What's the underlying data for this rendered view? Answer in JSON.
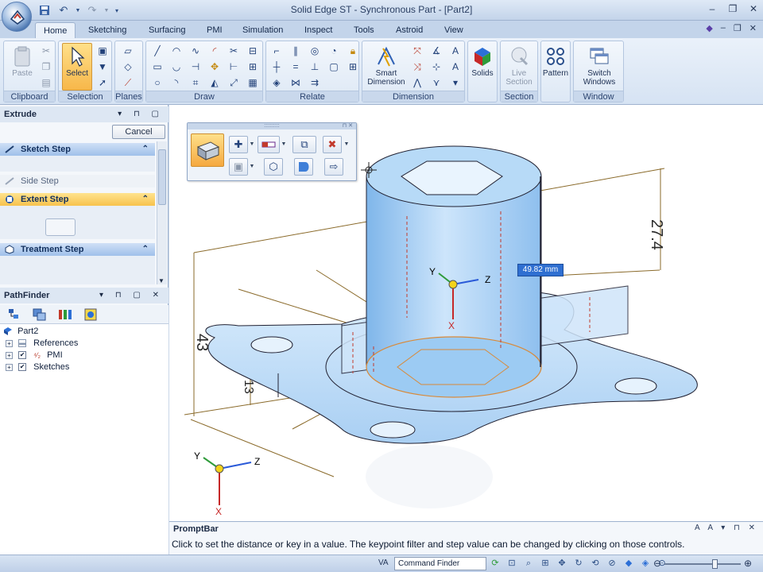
{
  "window": {
    "title": "Solid Edge ST - Synchronous Part - [Part2]",
    "controls": [
      "minimize",
      "restore",
      "close"
    ]
  },
  "quick_access": [
    "save-icon",
    "undo-icon",
    "redo-icon",
    "customize-icon"
  ],
  "tabs": [
    "Home",
    "Sketching",
    "Surfacing",
    "PMI",
    "Simulation",
    "Inspect",
    "Tools",
    "Astroid",
    "View"
  ],
  "active_tab": "Home",
  "ribbon": {
    "clipboard": {
      "label": "Clipboard",
      "paste": "Paste"
    },
    "selection": {
      "label": "Selection",
      "select": "Select"
    },
    "planes": {
      "label": "Planes"
    },
    "draw": {
      "label": "Draw"
    },
    "relate": {
      "label": "Relate"
    },
    "dimension": {
      "label": "Dimension",
      "smart_dimension_1": "Smart",
      "smart_dimension_2": "Dimension"
    },
    "solids": {
      "label": "Solids"
    },
    "section": {
      "label": "Section",
      "live_section_1": "Live",
      "live_section_2": "Section"
    },
    "pattern": {
      "label": "Pattern"
    },
    "window": {
      "label": "Window",
      "switch_windows_1": "Switch",
      "switch_windows_2": "Windows"
    }
  },
  "extrude_pane": {
    "title": "Extrude",
    "cancel": "Cancel",
    "steps": {
      "sketch": "Sketch Step",
      "side": "Side Step",
      "extent": "Extent Step",
      "treatment": "Treatment Step"
    }
  },
  "pathfinder": {
    "title": "PathFinder",
    "tree": {
      "root": "Part2",
      "items": [
        "References",
        "PMI",
        "Sketches"
      ]
    }
  },
  "viewport": {
    "dimension_label": "49.82 mm",
    "dims": {
      "height": "27.4",
      "left": "43",
      "small": "13"
    },
    "triad_axes": {
      "y": "Y",
      "z": "Z",
      "x": "X"
    }
  },
  "promptbar": {
    "title": "PromptBar",
    "text": "Click to set the distance or key in a value. The keypoint filter and step value can be changed by clicking on those controls."
  },
  "statusbar": {
    "va": "VA",
    "command_finder": "Command Finder"
  },
  "colors": {
    "accent": "#2f6fd1",
    "selected": "#f7b74a",
    "part_fill": "#a9d0f5"
  }
}
